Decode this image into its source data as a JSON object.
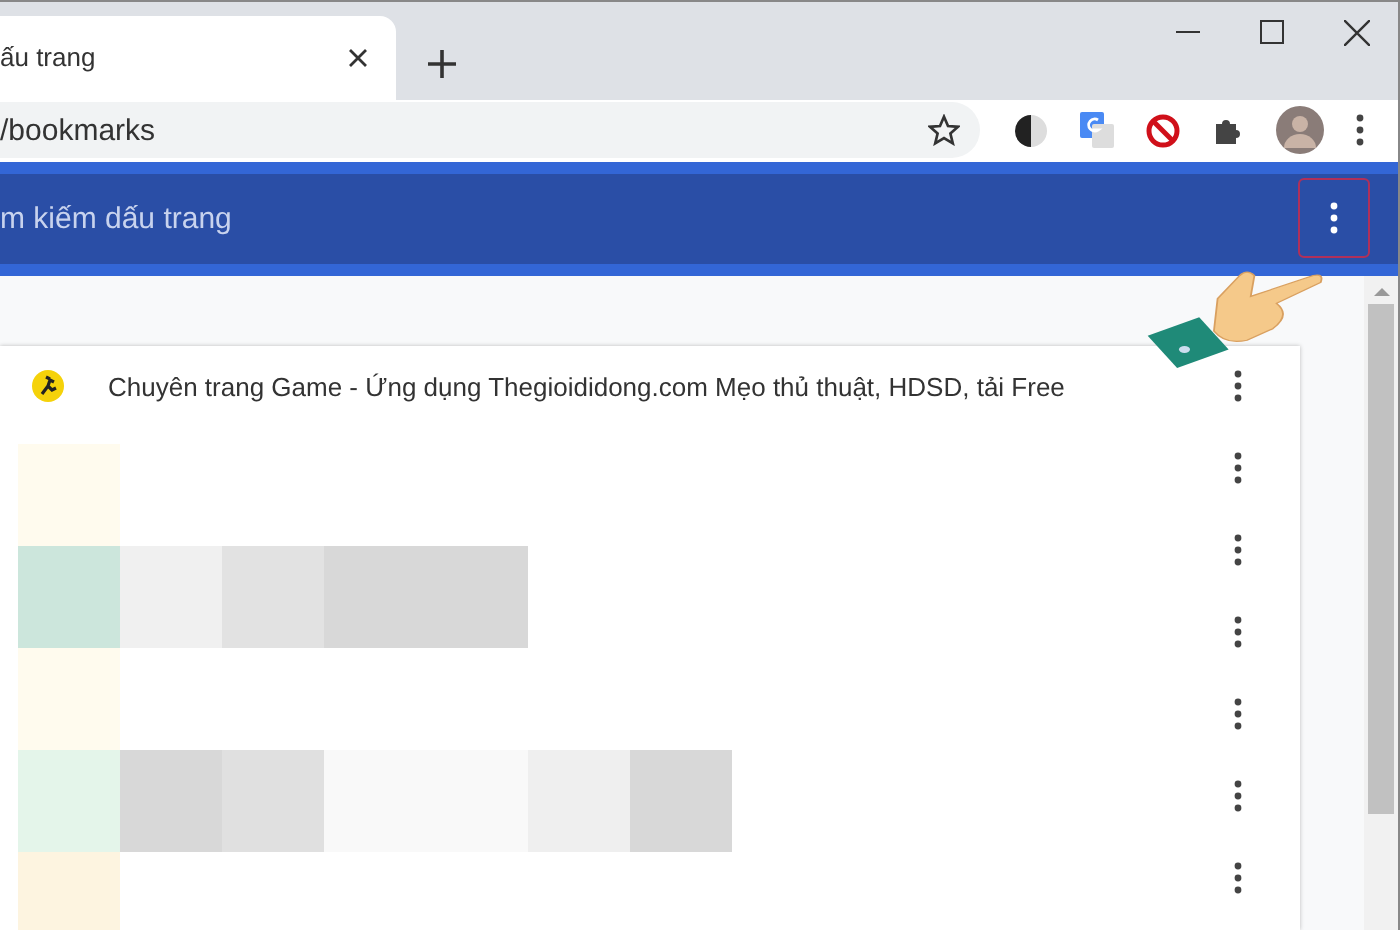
{
  "tab": {
    "title": "ấu trang",
    "selected": true
  },
  "address": {
    "value": "/bookmarks"
  },
  "search": {
    "placeholder": "m kiếm dấu trang"
  },
  "bookmarks": [
    {
      "kind": "titled",
      "title": "Chuyên trang Game - Ứng dụng Thegioididong.com Mẹo thủ thuật, HDSD, tải Free"
    },
    {
      "kind": "hidden"
    },
    {
      "kind": "hidden"
    },
    {
      "kind": "hidden"
    },
    {
      "kind": "hidden"
    },
    {
      "kind": "hidden"
    },
    {
      "kind": "hidden"
    }
  ]
}
